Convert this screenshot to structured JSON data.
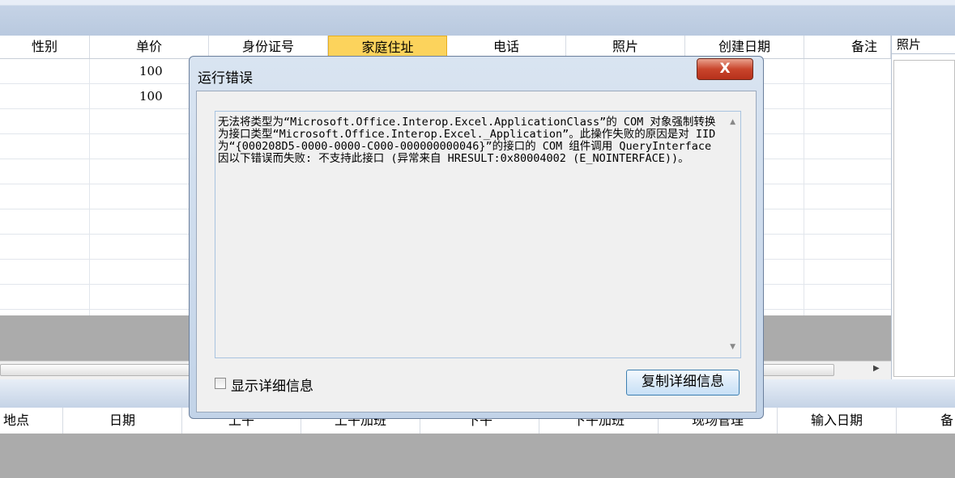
{
  "grid": {
    "columns": [
      "性别",
      "单价",
      "身份证号",
      "家庭住址",
      "电话",
      "照片",
      "创建日期",
      "备注"
    ],
    "rows": [
      {
        "price": "100"
      },
      {
        "price": "100"
      }
    ]
  },
  "photo_panel": {
    "title": "照片"
  },
  "bottom_grid": {
    "columns": [
      "地点",
      "日期",
      "上午",
      "上午加班",
      "下午",
      "下午加班",
      "现场管理",
      "输入日期",
      "备"
    ]
  },
  "dialog": {
    "title": "运行错误",
    "close_label": "X",
    "message": "无法将类型为“Microsoft.Office.Interop.Excel.ApplicationClass”的 COM 对象强制转换为接口类型“Microsoft.Office.Interop.Excel._Application”。此操作失败的原因是对 IID 为“{000208D5-0000-0000-C000-000000000046}”的接口的 COM 组件调用 QueryInterface 因以下错误而失败: 不支持此接口 (异常来自 HRESULT:0x80004002 (E_NOINTERFACE))。",
    "show_details_label": "显示详细信息",
    "copy_details_label": "复制详细信息"
  }
}
